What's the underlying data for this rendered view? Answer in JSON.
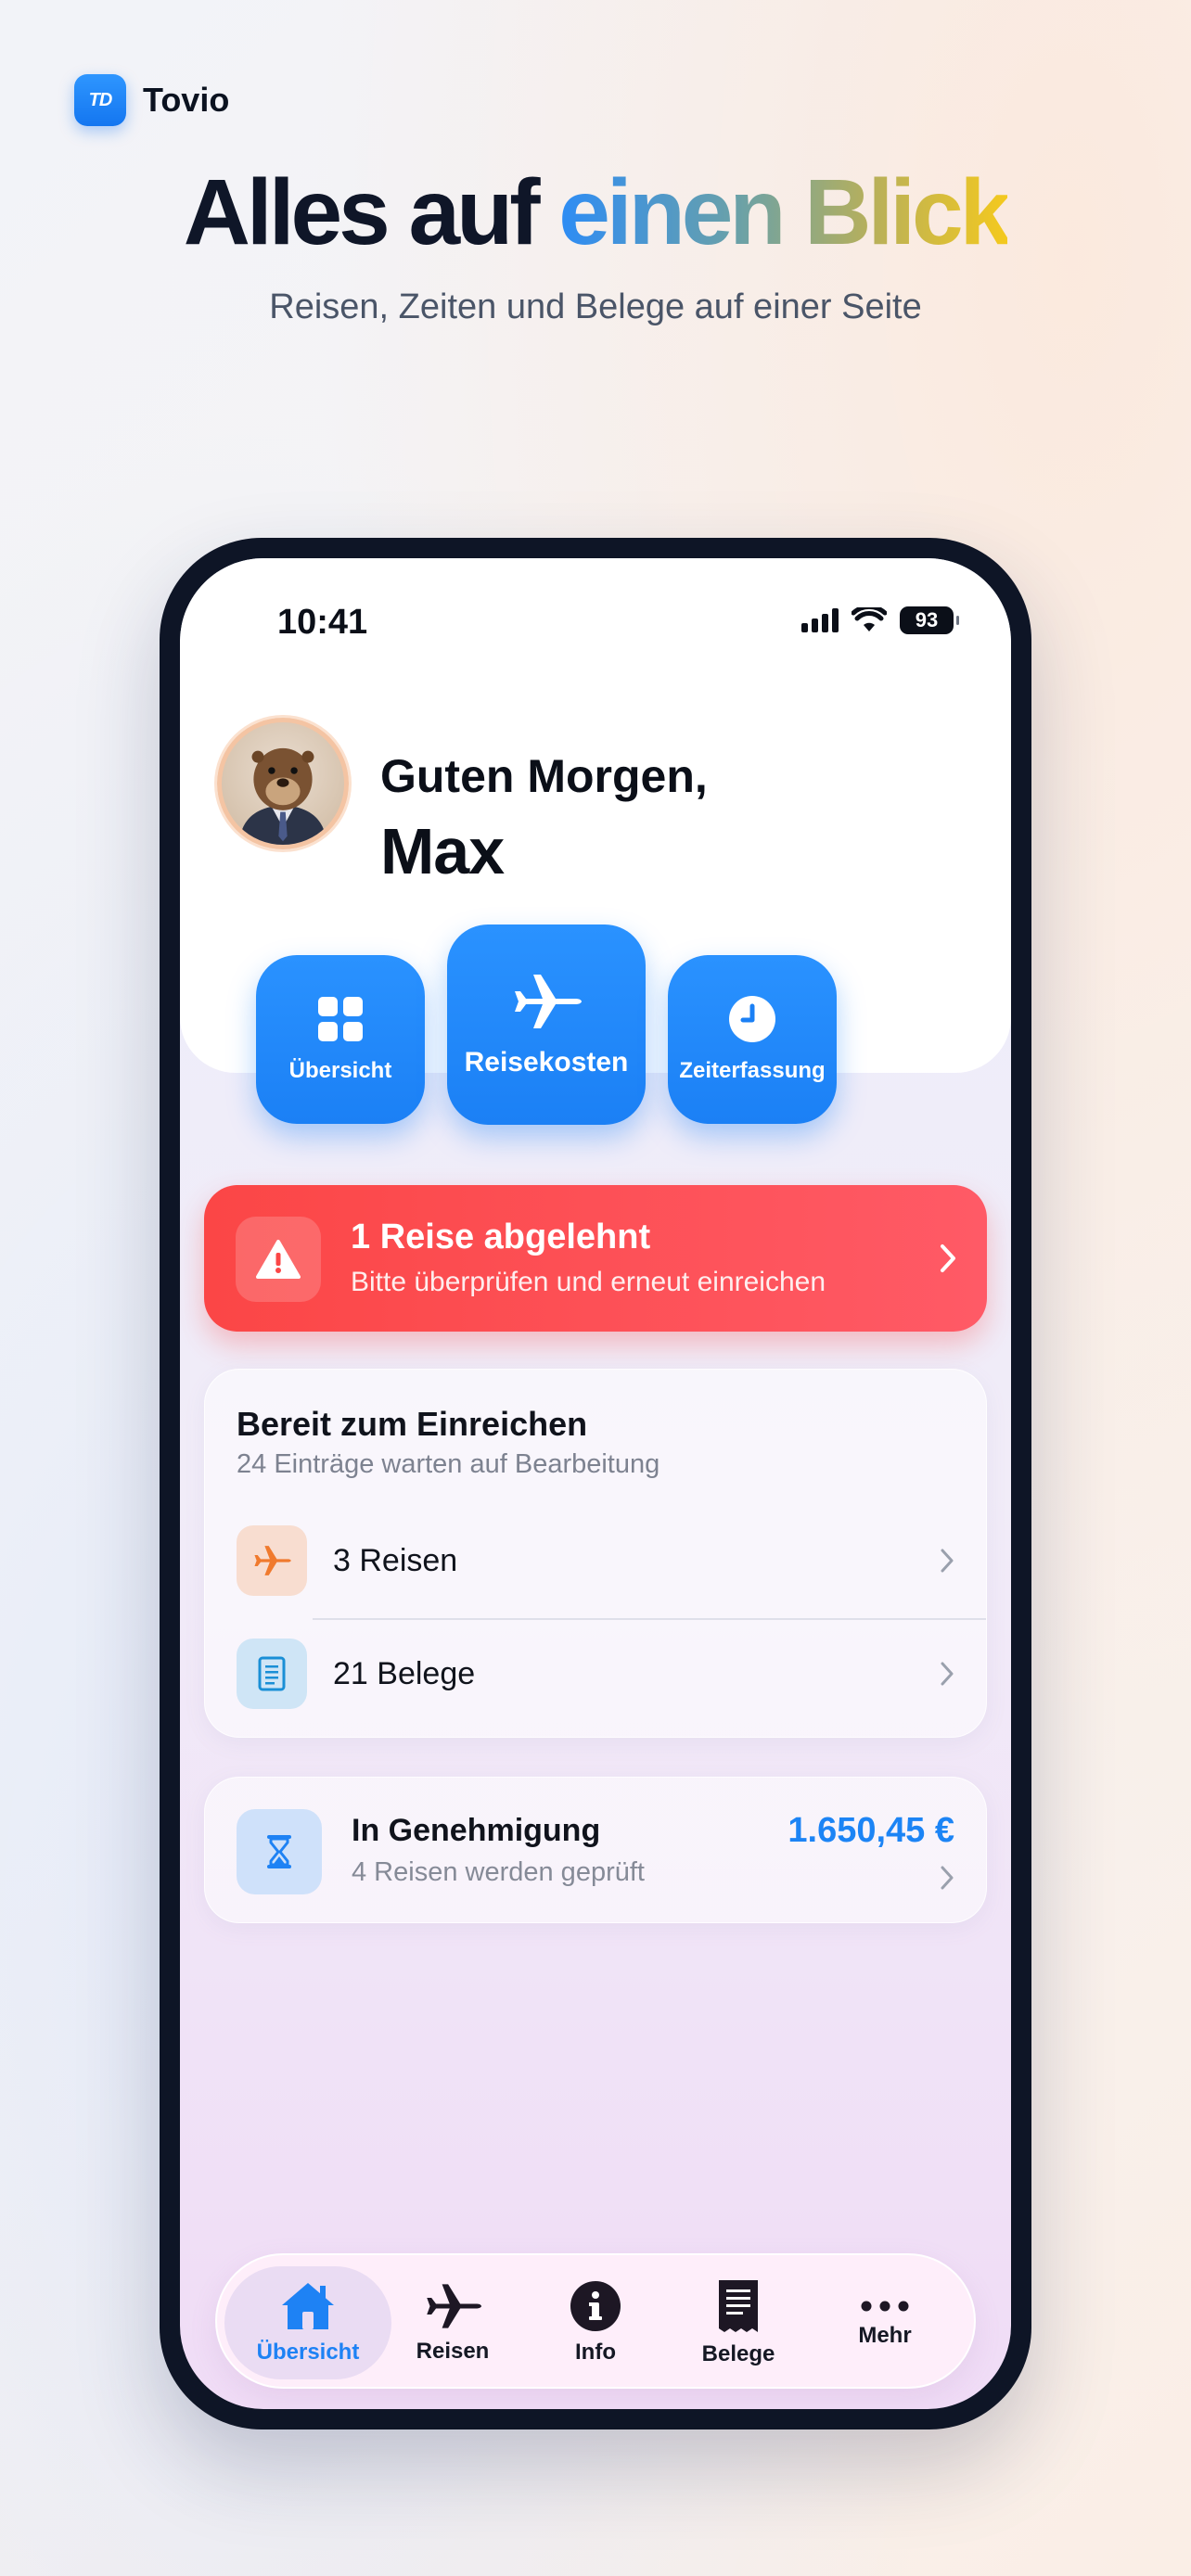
{
  "brand": {
    "logo_text": "TD",
    "name": "Tovio"
  },
  "headline": {
    "part1": "Alles auf ",
    "part2": "einen Blick"
  },
  "subline": "Reisen, Zeiten und Belege auf einer Seite",
  "status": {
    "time": "10:41",
    "battery": "93"
  },
  "greeting": {
    "line1": "Guten Morgen,",
    "name": "Max"
  },
  "quick_tiles": [
    {
      "label": "Übersicht",
      "icon": "grid-icon"
    },
    {
      "label": "Reisekosten",
      "icon": "airplane-icon"
    },
    {
      "label": "Zeiterfassung",
      "icon": "clock-icon"
    }
  ],
  "alert": {
    "title": "1 Reise abgelehnt",
    "subtitle": "Bitte überprüfen und erneut einreichen"
  },
  "ready": {
    "title": "Bereit zum Einreichen",
    "subtitle": "24 Einträge warten auf Bearbeitung",
    "rows": [
      {
        "label": "3 Reisen",
        "icon": "airplane-icon"
      },
      {
        "label": "21 Belege",
        "icon": "receipt-icon"
      }
    ]
  },
  "approval": {
    "title": "In Genehmigung",
    "subtitle": "4 Reisen werden geprüft",
    "amount": "1.650,45 €"
  },
  "tabs": [
    {
      "label": "Übersicht",
      "icon": "home-icon",
      "active": true
    },
    {
      "label": "Reisen",
      "icon": "airplane-icon"
    },
    {
      "label": "Info",
      "icon": "info-icon"
    },
    {
      "label": "Belege",
      "icon": "receipt-icon"
    },
    {
      "label": "Mehr",
      "icon": "more-icon"
    }
  ],
  "colors": {
    "accent": "#1E82F4",
    "alert": "#FB4646",
    "orange": "#F07A2E"
  }
}
